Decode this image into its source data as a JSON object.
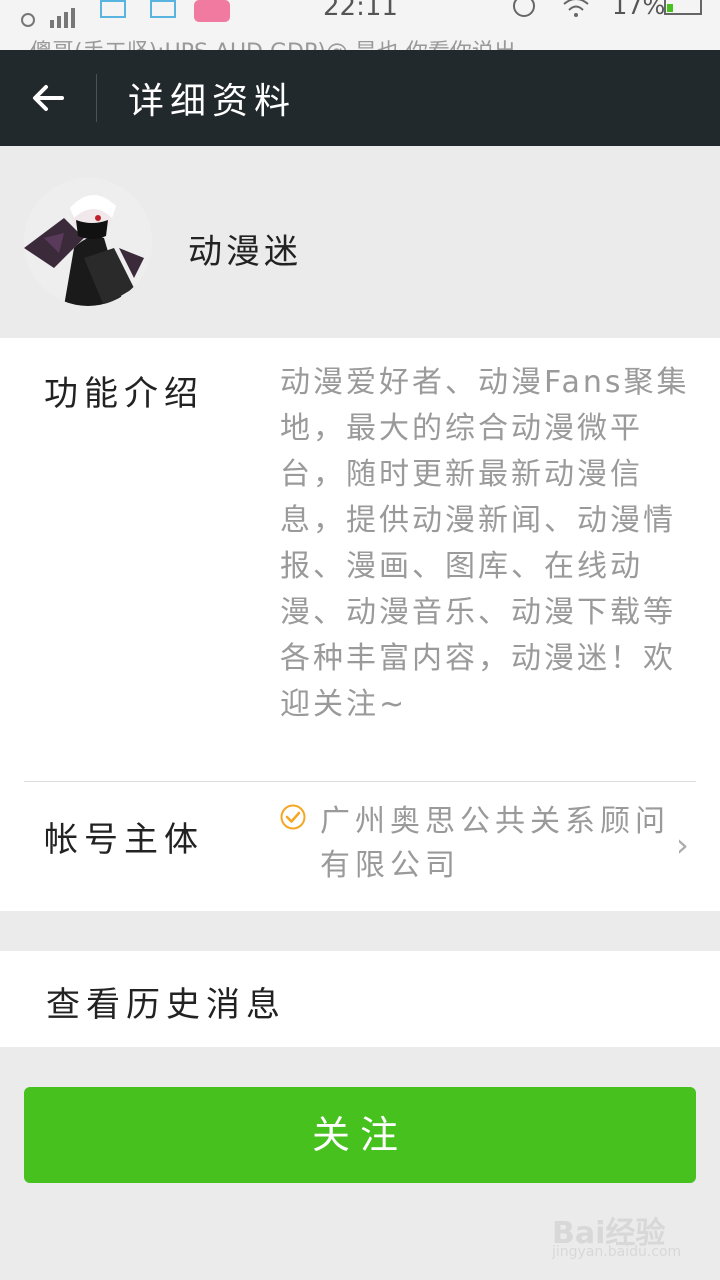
{
  "status_bar": {
    "time": "22:11",
    "battery": "17%",
    "ticker": "傻哥(手工坚):UPS AUD GDP)@ 是也 你看你说出"
  },
  "navbar": {
    "title": "详细资料"
  },
  "profile": {
    "name": "动漫迷"
  },
  "info": {
    "intro_label": "功能介绍",
    "intro_text": "动漫爱好者、动漫Fans聚集地，最大的综合动漫微平台，随时更新最新动漫信息，提供动漫新闻、动漫情报、漫画、图库、在线动漫、动漫音乐、动漫下载等各种丰富内容，动漫迷！欢迎关注~",
    "owner_label": "帐号主体",
    "owner_value": "广州奥思公共关系顾问有限公司",
    "chevron": "›"
  },
  "history": {
    "label": "查看历史消息"
  },
  "follow_button": {
    "label": "关注"
  },
  "watermark": {
    "logo": "Bai经验",
    "url": "jingyan.baidu.com"
  },
  "colors": {
    "navbar_bg": "#22292c",
    "accent_green": "#46c11e",
    "verify_orange": "#f5a623",
    "page_bg": "#ebebeb"
  },
  "icons": [
    "back-arrow-icon",
    "verified-badge-icon",
    "chevron-right-icon"
  ]
}
